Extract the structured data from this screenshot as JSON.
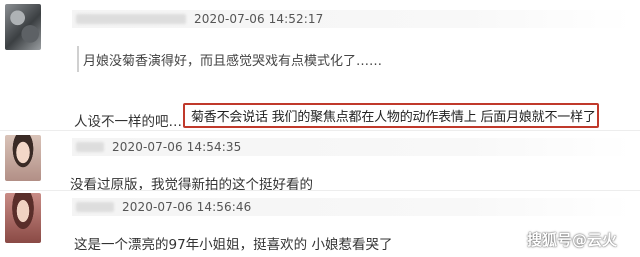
{
  "comments": [
    {
      "timestamp": "2020-07-06 14:52:17",
      "quoted_text": "月娘没菊香演得好，而且感觉哭戏有点模式化了……",
      "reply_text": "人设不一样的吧……",
      "highlighted_text": "菊香不会说话 我们的聚焦点都在人物的动作表情上 后面月娘就不一样了"
    },
    {
      "timestamp": "2020-07-06 14:54:35",
      "text": "没看过原版，我觉得新拍的这个挺好看的"
    },
    {
      "timestamp": "2020-07-06 14:56:46",
      "text": "这是一个漂亮的97年小姐姐，挺喜欢的 小娘惹看哭了"
    }
  ],
  "watermark": "搜狐号@云火",
  "colors": {
    "highlight_border": "#c0392b",
    "meta_bg": "#f4f4f4"
  }
}
